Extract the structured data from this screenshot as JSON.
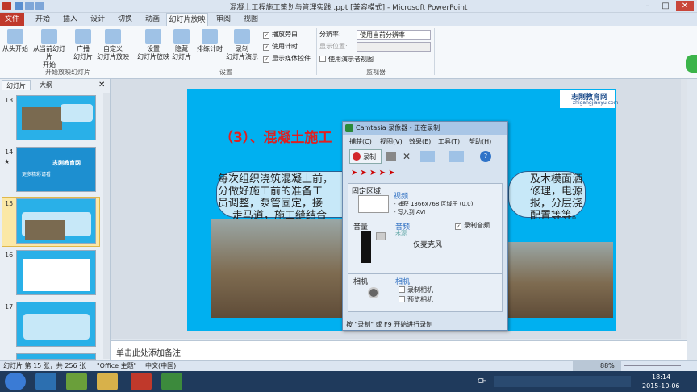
{
  "window": {
    "title": "混凝土工程施工策划与管理实践 .ppt [兼容模式] - Microsoft PowerPoint"
  },
  "tabs": [
    "文件",
    "开始",
    "插入",
    "设计",
    "切换",
    "动画",
    "幻灯片放映",
    "审阅",
    "视图"
  ],
  "ribbon": {
    "from_start": "从头开始",
    "from_current_1": "从当前幻灯片",
    "from_current_2": "开始",
    "broadcast_1": "广播",
    "broadcast_2": "幻灯片",
    "custom_1": "自定义",
    "custom_2": "幻灯片放映",
    "group1": "开始放映幻灯片",
    "setup_1": "设置",
    "setup_2": "幻灯片放映",
    "hide_1": "隐藏",
    "hide_2": "幻灯片",
    "rehearse": "排练计时",
    "record_1": "录制",
    "record_2": "幻灯片演示",
    "chk_narration": "播放旁白",
    "chk_timing": "使用计时",
    "chk_media": "显示媒体控件",
    "group2": "设置",
    "resolution_label": "分辨率:",
    "resolution_value": "使用当前分辨率",
    "show_on_label": "显示位置:",
    "presenter_view": "使用演示者视图",
    "group3": "监视器"
  },
  "leftpane": {
    "tab1": "幻灯片",
    "tab2": "大纲",
    "numbers": [
      "13",
      "14",
      "15",
      "16",
      "17"
    ]
  },
  "thumb14": {
    "line1": "志刚教育网",
    "line2": "更多精彩请看",
    "side": "★"
  },
  "slide": {
    "logo": "志刚教育网",
    "logo_sub": "zhigangjiaoyu.com",
    "heading": "（3）、混凝土施工",
    "bubble_left_1": "每次组织浇筑混凝土前，",
    "bubble_left_2": "分做好施工前的准备工",
    "bubble_left_3": "员调整，泵管固定，接",
    "bubble_left_4": "走马道，施工缝结合",
    "bubble_right_1": "及木模面洒",
    "bubble_right_2": "修理，电源",
    "bubble_right_3": "报，分层浇",
    "bubble_right_4": "配置等等。"
  },
  "camtasia": {
    "title": "Camtasia 录像器 - 正在录制",
    "menu": [
      "捕获(C)",
      "视图(V)",
      "效果(E)",
      "工具(T)",
      "帮助(H)"
    ],
    "record_btn": "录制",
    "region_label": "固定区域",
    "video_label": "视频",
    "video_line1": "- 捕获 1366x768 区域于 (0,0)",
    "video_line2": "- 写入到 AVI",
    "volume_label": "音量",
    "audio_label": "音频",
    "audio_none": "未源",
    "mic": "仅麦克风",
    "record_audio": "录制音频",
    "camera_label": "相机",
    "camera_label2": "相机",
    "record_camera": "录制相机",
    "preview_camera": "预览相机",
    "status": "按 \"录制\" 或 F9 开始进行录制"
  },
  "notes": {
    "placeholder": "单击此处添加备注"
  },
  "status": {
    "slide": "幻灯片 第 15 张，共 256 张",
    "theme": "\"Office 主题\"",
    "lang": "中文(中国)",
    "zoom": "88%"
  },
  "taskbar": {
    "ime": "CH",
    "time": "18:14",
    "date": "2015-10-06"
  },
  "colors": {
    "accent": "#c0392b",
    "slide_bg": "#00b0f0",
    "heading": "#e02020"
  }
}
